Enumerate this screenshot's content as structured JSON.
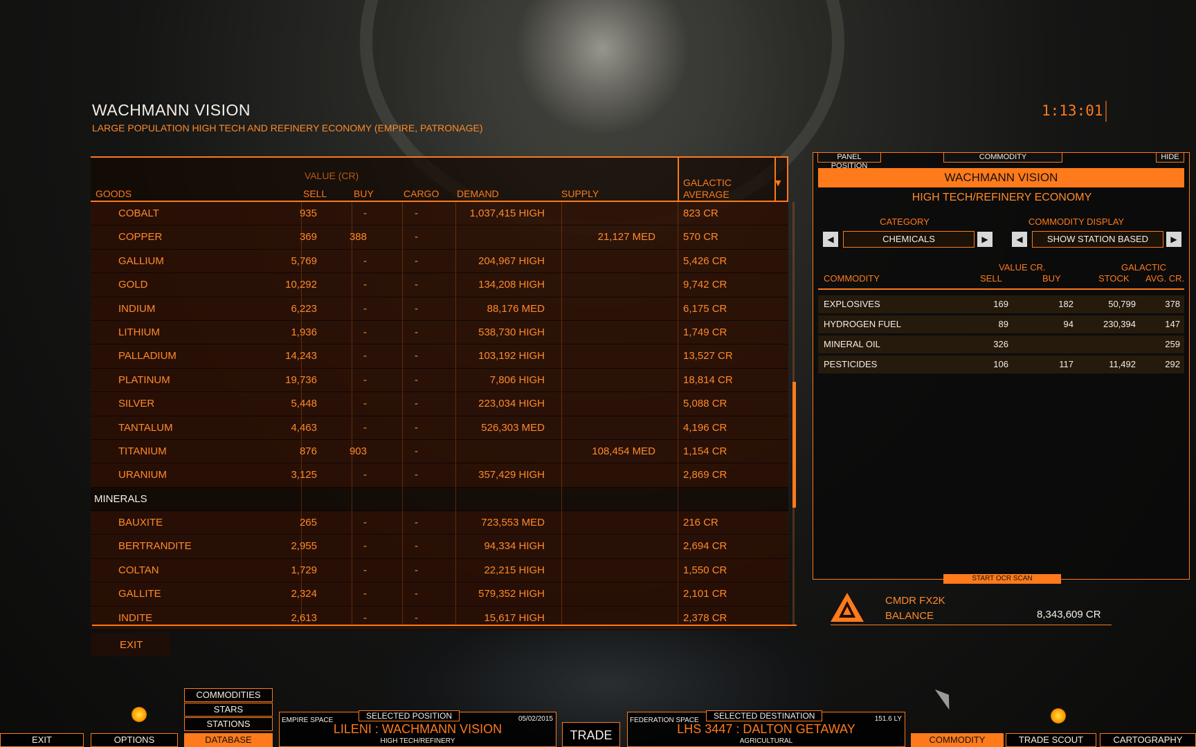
{
  "station": {
    "name": "WACHMANN VISION",
    "description": "LARGE POPULATION HIGH TECH AND REFINERY ECONOMY (EMPIRE, PATRONAGE)"
  },
  "clock": "1:13:01",
  "market": {
    "headers": {
      "goods": "GOODS",
      "value_group": "VALUE (CR)",
      "sell": "SELL",
      "buy": "BUY",
      "cargo": "CARGO",
      "demand": "DEMAND",
      "supply": "SUPPLY",
      "galactic_1": "GALACTIC",
      "galactic_2": "AVERAGE"
    },
    "rows": [
      {
        "type": "item",
        "name": "COBALT",
        "sell": "935",
        "buy": "-",
        "cargo": "-",
        "demand": "1,037,415 HIGH",
        "supply": "",
        "avg": "823 CR"
      },
      {
        "type": "item",
        "name": "COPPER",
        "sell": "369",
        "buy": "388",
        "cargo": "-",
        "demand": "",
        "supply": "21,127 MED",
        "avg": "570 CR"
      },
      {
        "type": "item",
        "name": "GALLIUM",
        "sell": "5,769",
        "buy": "-",
        "cargo": "-",
        "demand": "204,967 HIGH",
        "supply": "",
        "avg": "5,426 CR"
      },
      {
        "type": "item",
        "name": "GOLD",
        "sell": "10,292",
        "buy": "-",
        "cargo": "-",
        "demand": "134,208 HIGH",
        "supply": "",
        "avg": "9,742 CR"
      },
      {
        "type": "item",
        "name": "INDIUM",
        "sell": "6,223",
        "buy": "-",
        "cargo": "-",
        "demand": "88,176 MED",
        "supply": "",
        "avg": "6,175 CR"
      },
      {
        "type": "item",
        "name": "LITHIUM",
        "sell": "1,936",
        "buy": "-",
        "cargo": "-",
        "demand": "538,730 HIGH",
        "supply": "",
        "avg": "1,749 CR"
      },
      {
        "type": "item",
        "name": "PALLADIUM",
        "sell": "14,243",
        "buy": "-",
        "cargo": "-",
        "demand": "103,192 HIGH",
        "supply": "",
        "avg": "13,527 CR"
      },
      {
        "type": "item",
        "name": "PLATINUM",
        "sell": "19,736",
        "buy": "-",
        "cargo": "-",
        "demand": "7,806 HIGH",
        "supply": "",
        "avg": "18,814 CR"
      },
      {
        "type": "item",
        "name": "SILVER",
        "sell": "5,448",
        "buy": "-",
        "cargo": "-",
        "demand": "223,034 HIGH",
        "supply": "",
        "avg": "5,088 CR"
      },
      {
        "type": "item",
        "name": "TANTALUM",
        "sell": "4,463",
        "buy": "-",
        "cargo": "-",
        "demand": "526,303 MED",
        "supply": "",
        "avg": "4,196 CR"
      },
      {
        "type": "item",
        "name": "TITANIUM",
        "sell": "876",
        "buy": "903",
        "cargo": "-",
        "demand": "",
        "supply": "108,454 MED",
        "avg": "1,154 CR"
      },
      {
        "type": "item",
        "name": "URANIUM",
        "sell": "3,125",
        "buy": "-",
        "cargo": "-",
        "demand": "357,429 HIGH",
        "supply": "",
        "avg": "2,869 CR"
      },
      {
        "type": "category",
        "name": "MINERALS"
      },
      {
        "type": "item",
        "name": "BAUXITE",
        "sell": "265",
        "buy": "-",
        "cargo": "-",
        "demand": "723,553 MED",
        "supply": "",
        "avg": "216 CR"
      },
      {
        "type": "item",
        "name": "BERTRANDITE",
        "sell": "2,955",
        "buy": "-",
        "cargo": "-",
        "demand": "94,334 HIGH",
        "supply": "",
        "avg": "2,694 CR"
      },
      {
        "type": "item",
        "name": "COLTAN",
        "sell": "1,729",
        "buy": "-",
        "cargo": "-",
        "demand": "22,215 HIGH",
        "supply": "",
        "avg": "1,550 CR"
      },
      {
        "type": "item",
        "name": "GALLITE",
        "sell": "2,324",
        "buy": "-",
        "cargo": "-",
        "demand": "579,352 HIGH",
        "supply": "",
        "avg": "2,101 CR"
      },
      {
        "type": "item",
        "name": "INDITE",
        "sell": "2,613",
        "buy": "-",
        "cargo": "-",
        "demand": "15,617 HIGH",
        "supply": "",
        "avg": "2,378 CR"
      }
    ],
    "exit_label": "EXIT"
  },
  "commodity_panel": {
    "tabs": {
      "panel_position": "PANEL POSITION",
      "commodity": "COMMODITY",
      "hide": "HIDE"
    },
    "title": "WACHMANN VISION",
    "economy": "HIGH TECH/REFINERY ECONOMY",
    "category_label": "CATEGORY",
    "category_value": "CHEMICALS",
    "display_label": "COMMODITY DISPLAY",
    "display_value": "SHOW STATION BASED",
    "headers": {
      "commodity": "COMMODITY",
      "value_cr": "VALUE CR.",
      "sell": "SELL",
      "buy": "BUY",
      "stock": "STOCK",
      "galactic": "GALACTIC",
      "avg_cr": "AVG. CR."
    },
    "rows": [
      {
        "name": "EXPLOSIVES",
        "sell": "169",
        "buy": "182",
        "stock": "50,799",
        "avg": "378"
      },
      {
        "name": "HYDROGEN FUEL",
        "sell": "89",
        "buy": "94",
        "stock": "230,394",
        "avg": "147"
      },
      {
        "name": "MINERAL OIL",
        "sell": "326",
        "buy": "",
        "stock": "",
        "avg": "259"
      },
      {
        "name": "PESTICIDES",
        "sell": "106",
        "buy": "117",
        "stock": "11,492",
        "avg": "292"
      }
    ],
    "ocr_button": "START OCR SCAN"
  },
  "commander": {
    "name": "CMDR FX2K",
    "balance_label": "BALANCE",
    "balance": "8,343,609 CR"
  },
  "bottom_nav": {
    "exit": "EXIT",
    "options": "OPTIONS",
    "commodities": "COMMODITIES",
    "stars": "STARS",
    "stations": "STATIONS",
    "database": "DATABASE",
    "trade": "TRADE",
    "commodity": "COMMODITY",
    "trade_scout": "TRADE SCOUT",
    "cartography": "CARTOGRAPHY"
  },
  "selected_position": {
    "label": "SELECTED POSITION",
    "region": "EMPIRE SPACE",
    "date": "05/02/2015",
    "location": "LILENI : WACHMANN VISION",
    "economy": "HIGH TECH/REFINERY"
  },
  "selected_destination": {
    "label": "SELECTED DESTINATION",
    "region": "FEDERATION SPACE",
    "distance": "151.6 LY",
    "location": "LHS 3447 : DALTON GETAWAY",
    "economy": "AGRICULTURAL"
  },
  "colors": {
    "accent": "#ff7a1a",
    "text_light": "#f4efe6",
    "background": "#0b0b0a"
  }
}
